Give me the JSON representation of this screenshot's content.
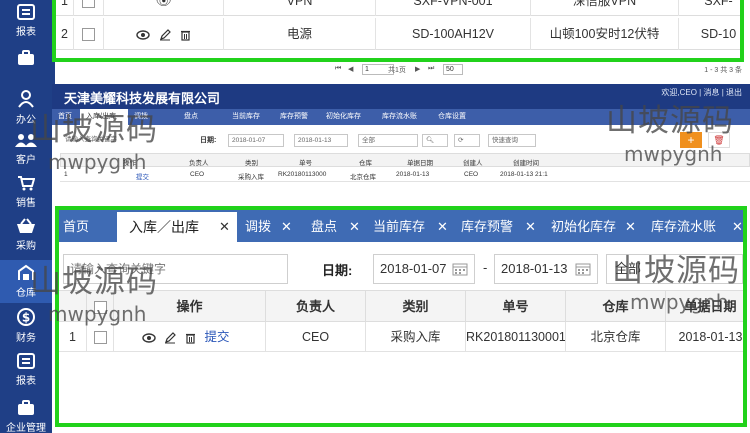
{
  "top_panel": {
    "rows": [
      {
        "num": "1",
        "name": "VPN",
        "code": "SXF-VPN-001",
        "desc": "深信服VPN",
        "extra": "SXF-"
      },
      {
        "num": "2",
        "name": "电源",
        "code": "SD-100AH12V",
        "desc": "山顿100安时12伏特",
        "extra": "SD-10"
      }
    ],
    "pager": {
      "first": "⏮",
      "prev": "◀",
      "page": "1",
      "page_text": "共1页",
      "next": "▶",
      "last": "⏭",
      "page_size": "50",
      "summary": "1 - 3 共 3 条"
    }
  },
  "sidebar_top": {
    "item_label": "报表"
  },
  "sidebar": {
    "items": [
      {
        "label": "办公"
      },
      {
        "label": "客户"
      },
      {
        "label": "销售"
      },
      {
        "label": "采购"
      },
      {
        "label": "仓库"
      },
      {
        "label": "财务"
      },
      {
        "label": "报表"
      },
      {
        "label": "企业管理"
      }
    ]
  },
  "header": {
    "company": "天津美耀科技发展有限公司",
    "right_text": "欢迎,CEO | 消息 | 退出"
  },
  "small_tabs": [
    "首页",
    "入库/出库",
    "调拨",
    "盘点",
    "当前库存",
    "库存预警",
    "初始化库存",
    "库存流水账",
    "仓库设置"
  ],
  "small_toolbar": {
    "search_placeholder": "请输入查询关键字",
    "date_label": "日期:",
    "date_from": "2018-01-07",
    "date_to": "2018-01-13",
    "type": "全部",
    "quick_query": "快速查询"
  },
  "small_grid": {
    "headers": [
      "操作",
      "负责人",
      "类别",
      "单号",
      "仓库",
      "单据日期",
      "创建人",
      "创建时间"
    ],
    "row": [
      "提交",
      "CEO",
      "采购入库",
      "RK20180113000",
      "北京仓库",
      "2018-01-13",
      "CEO",
      "2018-01-13 21:1"
    ]
  },
  "tabs": [
    "首页",
    "入库／出库",
    "调拨",
    "盘点",
    "当前库存",
    "库存预警",
    "初始化库存",
    "库存流水账"
  ],
  "filter": {
    "search_placeholder": "请输入查询关键字",
    "date_label": "日期:",
    "date_from": "2018-01-07",
    "date_sep": "-",
    "date_to": "2018-01-13",
    "type": "全部"
  },
  "grid": {
    "headers": {
      "action": "操作",
      "owner": "负责人",
      "category": "类别",
      "number": "单号",
      "warehouse": "仓库",
      "date": "单据日期"
    },
    "row": {
      "num": "1",
      "submit": "提交",
      "owner": "CEO",
      "category": "采购入库",
      "number": "RK201801130001",
      "warehouse": "北京仓库",
      "date": "2018-01-13"
    }
  },
  "watermark": {
    "text": "山坡源码",
    "sub": "mwpygnh"
  },
  "colors": {
    "nav": "#1f3f86",
    "tabs": "#3f6bb4",
    "highlight": "#21d21b",
    "orange": "#f0901e"
  }
}
